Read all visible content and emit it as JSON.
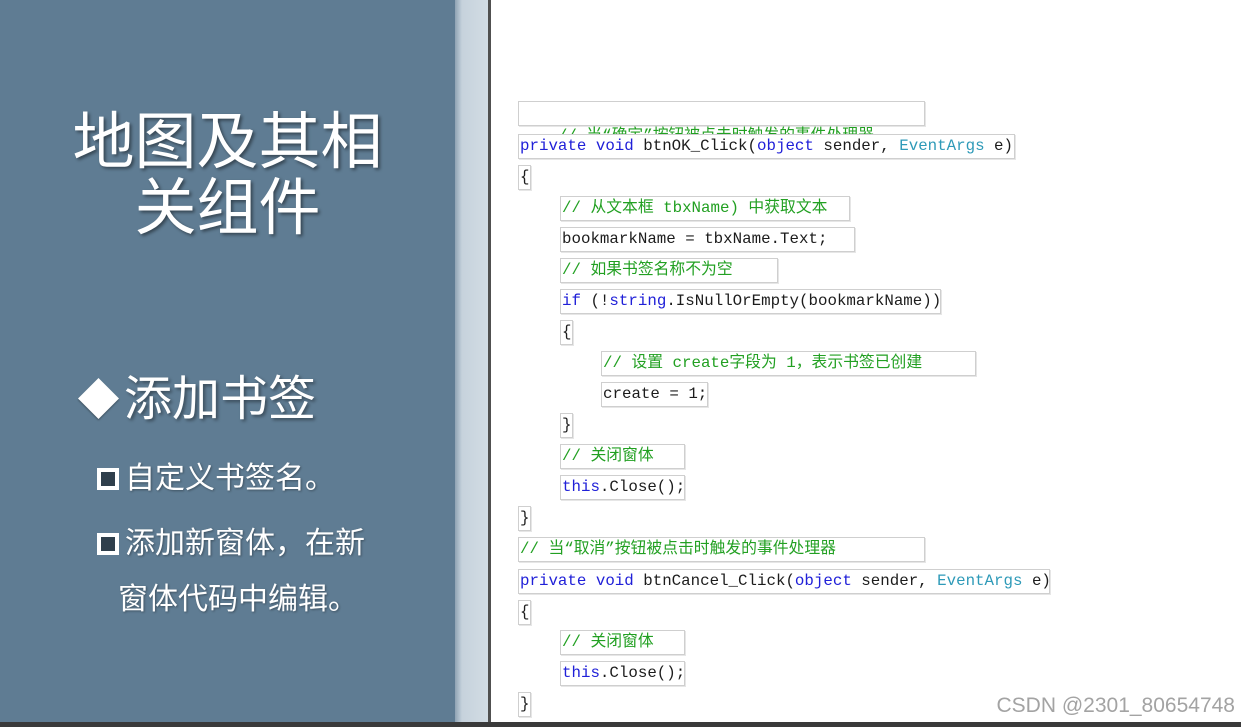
{
  "slide": {
    "title_line1": "地图及其相",
    "title_line2": "关组件",
    "bullet": "添加书签",
    "sub_items": [
      "自定义书签名。",
      "添加新窗体，在新"
    ],
    "sub_item_continuation": "窗体代码中编辑。"
  },
  "icons": {
    "main_bullet": "diamond-icon",
    "sub_bullet": "hollow-square-icon"
  },
  "code": {
    "lines": [
      [
        "// 当“确定”按钮被点击时触发的事件处理器"
      ],
      [
        "private void",
        " btnOK_Click(",
        "object",
        " sender, ",
        "EventArgs",
        " e)"
      ],
      [
        "{"
      ],
      [
        "// 从文本框 tbxName) 中获取文本"
      ],
      [
        "bookmarkName = tbxName.Text;"
      ],
      [
        "// 如果书签名称不为空"
      ],
      [
        "if",
        " (!",
        "string",
        ".IsNullOrEmpty(bookmarkName))"
      ],
      [
        "{"
      ],
      [
        "// 设置 create字段为 1，表示书签已创建"
      ],
      [
        "create = 1;"
      ],
      [
        "}"
      ],
      [
        "// 关闭窗体"
      ],
      [
        "this",
        ".Close();"
      ],
      [
        "}"
      ],
      [
        "// 当“取消”按钮被点击时触发的事件处理器"
      ],
      [
        "private void",
        " btnCancel_Click(",
        "object",
        " sender, ",
        "EventArgs",
        " e)"
      ],
      [
        "{"
      ],
      [
        "// 关闭窗体"
      ],
      [
        "this",
        ".Close();"
      ],
      [
        "}"
      ]
    ]
  },
  "watermark": "CSDN @2301_80654748",
  "colors": {
    "panel": "#5f7c93",
    "keyword": "#2020d8",
    "comment": "#22a022",
    "type": "#2e9ab8",
    "text": "#1c1c1c"
  }
}
